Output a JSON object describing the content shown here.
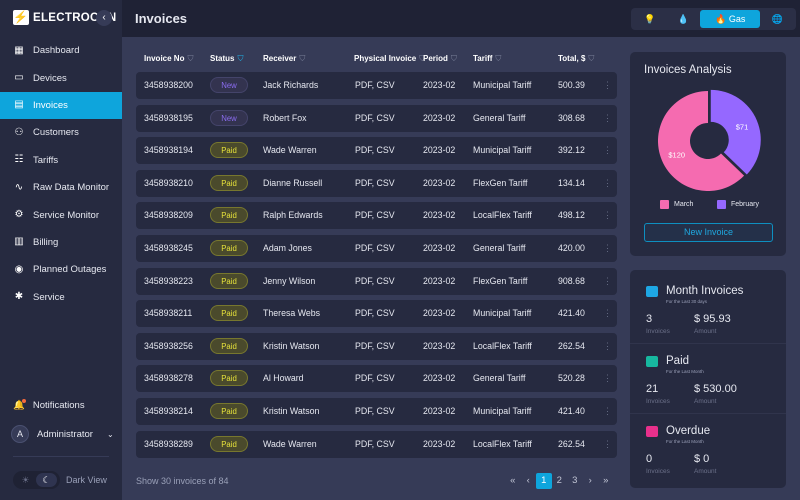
{
  "app": {
    "logo_icon": "⚡",
    "name": "ELECTROCON",
    "collapse_icon": "‹"
  },
  "header": {
    "title": "Invoices",
    "utilities": [
      {
        "name": "electricity",
        "icon": "💡"
      },
      {
        "name": "water",
        "icon": "💧"
      },
      {
        "name": "gas",
        "icon": "🔥",
        "label": "Gas"
      },
      {
        "name": "internet",
        "icon": "🌐"
      }
    ]
  },
  "sidebar": {
    "items": [
      {
        "label": "Dashboard",
        "icon": "▦"
      },
      {
        "label": "Devices",
        "icon": "▭"
      },
      {
        "label": "Invoices",
        "icon": "▤"
      },
      {
        "label": "Customers",
        "icon": "⚇"
      },
      {
        "label": "Tariffs",
        "icon": "☷"
      },
      {
        "label": "Raw Data Monitor",
        "icon": "∿"
      },
      {
        "label": "Service Monitor",
        "icon": "⚙"
      },
      {
        "label": "Billing",
        "icon": "▥"
      },
      {
        "label": "Planned Outages",
        "icon": "◉"
      },
      {
        "label": "Service",
        "icon": "✱"
      }
    ],
    "notifications": "Notifications",
    "user_initial": "A",
    "user": "Administrator",
    "theme_label": "Dark View"
  },
  "table": {
    "columns": [
      "Invoice No",
      "Status",
      "Receiver",
      "Physical Invoice",
      "Period",
      "Tariff",
      "Total, $"
    ],
    "rows": [
      [
        "3458938200",
        "New",
        "Jack Richards",
        "PDF, CSV",
        "2023-02",
        "Municipal Tariff",
        "500.39"
      ],
      [
        "3458938195",
        "New",
        "Robert Fox",
        "PDF, CSV",
        "2023-02",
        "General Tariff",
        "308.68"
      ],
      [
        "3458938194",
        "Paid",
        "Wade Warren",
        "PDF, CSV",
        "2023-02",
        "Municipal Tariff",
        "392.12"
      ],
      [
        "3458938210",
        "Paid",
        "Dianne Russell",
        "PDF, CSV",
        "2023-02",
        "FlexGen Tariff",
        "134.14"
      ],
      [
        "3458938209",
        "Paid",
        "Ralph Edwards",
        "PDF, CSV",
        "2023-02",
        "LocalFlex Tariff",
        "498.12"
      ],
      [
        "3458938245",
        "Paid",
        "Adam Jones",
        "PDF, CSV",
        "2023-02",
        "General Tariff",
        "420.00"
      ],
      [
        "3458938223",
        "Paid",
        "Jenny Wilson",
        "PDF, CSV",
        "2023-02",
        "FlexGen Tariff",
        "908.68"
      ],
      [
        "3458938211",
        "Paid",
        "Theresa Webs",
        "PDF, CSV",
        "2023-02",
        "Municipal Tariff",
        "421.40"
      ],
      [
        "3458938256",
        "Paid",
        "Kristin Watson",
        "PDF, CSV",
        "2023-02",
        "LocalFlex Tariff",
        "262.54"
      ],
      [
        "3458938278",
        "Paid",
        "Al Howard",
        "PDF, CSV",
        "2023-02",
        "General Tariff",
        "520.28"
      ],
      [
        "3458938214",
        "Paid",
        "Kristin Watson",
        "PDF, CSV",
        "2023-02",
        "Municipal Tariff",
        "421.40"
      ],
      [
        "3458938289",
        "Paid",
        "Wade Warren",
        "PDF, CSV",
        "2023-02",
        "LocalFlex Tariff",
        "262.54"
      ]
    ],
    "footer": "Show 30 invoices of 84",
    "pager": [
      "«",
      "‹",
      "1",
      "2",
      "3",
      "›",
      "»"
    ],
    "current_page": "1"
  },
  "analysis": {
    "title": "Invoices Analysis",
    "new_invoice": "New Invoice"
  },
  "chart_data": {
    "type": "pie",
    "title": "Invoices Analysis",
    "donut": true,
    "slices": [
      {
        "label": "March",
        "value": 120,
        "display": "$120",
        "color": "#f56bb0"
      },
      {
        "label": "February",
        "value": 71,
        "display": "$71",
        "color": "#9568ff"
      }
    ],
    "legend": "bottom"
  },
  "stats": [
    {
      "title": "Month Invoices",
      "subtitle": "For the Last 30 days",
      "count": "3",
      "count_label": "Invoices",
      "amount": "$ 95.93",
      "amount_label": "Amount",
      "color": "#1ea7e4"
    },
    {
      "title": "Paid",
      "subtitle": "For the Last Month",
      "count": "21",
      "count_label": "Invoices",
      "amount": "$ 530.00",
      "amount_label": "Amount",
      "color": "#17b8a0"
    },
    {
      "title": "Overdue",
      "subtitle": "For the Last Month",
      "count": "0",
      "count_label": "Invoices",
      "amount": "$ 0",
      "amount_label": "Amount",
      "color": "#e8308c"
    }
  ]
}
